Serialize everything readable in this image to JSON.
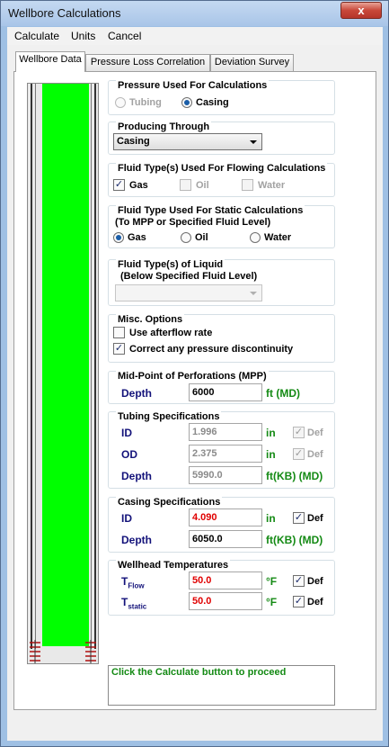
{
  "window": {
    "title": "Wellbore Calculations",
    "close_glyph": "x"
  },
  "menu": {
    "items": [
      "Calculate",
      "Units",
      "Cancel"
    ]
  },
  "tabs": [
    "Wellbore Data",
    "Pressure Loss Correlation",
    "Deviation Survey"
  ],
  "pressure_used": {
    "title": "Pressure Used For Calculations",
    "options": [
      "Tubing",
      "Casing"
    ],
    "selected": "Casing"
  },
  "producing_through": {
    "title": "Producing Through",
    "value": "Casing"
  },
  "flowing_fluid": {
    "title": "Fluid Type(s) Used For Flowing Calculations",
    "options": [
      "Gas",
      "Oil",
      "Water"
    ],
    "checked": [
      "Gas"
    ]
  },
  "static_fluid": {
    "title_line1": "Fluid Type Used For Static Calculations",
    "title_line2": "(To MPP or Specified Fluid Level)",
    "options": [
      "Gas",
      "Oil",
      "Water"
    ],
    "selected": "Gas"
  },
  "liquid_fluid": {
    "title_line1": "Fluid Type(s) of Liquid",
    "title_line2": "(Below Specified Fluid Level)",
    "value": ""
  },
  "misc": {
    "title": "Misc. Options",
    "afterflow_label": "Use afterflow rate",
    "afterflow_checked": false,
    "discontinuity_label": "Correct any pressure discontinuity",
    "discontinuity_checked": true
  },
  "mpp": {
    "title": "Mid-Point of Perforations (MPP)",
    "depth_label": "Depth",
    "depth_value": "6000",
    "depth_unit": "ft (MD)"
  },
  "tubing": {
    "title": "Tubing Specifications",
    "id_label": "ID",
    "id_value": "1.996",
    "id_unit": "in",
    "od_label": "OD",
    "od_value": "2.375",
    "od_unit": "in",
    "depth_label": "Depth",
    "depth_value": "5990.0",
    "depth_unit": "ft(KB) (MD)",
    "def_label": "Def"
  },
  "casing": {
    "title": "Casing Specifications",
    "id_label": "ID",
    "id_value": "4.090",
    "id_unit": "in",
    "depth_label": "Depth",
    "depth_value": "6050.0",
    "depth_unit": "ft(KB) (MD)",
    "def_label": "Def"
  },
  "temps": {
    "title": "Wellhead Temperatures",
    "tflow_label": "T",
    "tflow_sub": "Flow",
    "tflow_value": "50.0",
    "tstatic_label": "T",
    "tstatic_sub": "static",
    "tstatic_value": "50.0",
    "unit": "°F",
    "def_label": "Def"
  },
  "status_text": "Click the Calculate button to proceed",
  "colors": {
    "fluid": "#00ff00",
    "labels_blue": "#13127a",
    "units_green": "#148a14",
    "values_red": "#e00000"
  }
}
